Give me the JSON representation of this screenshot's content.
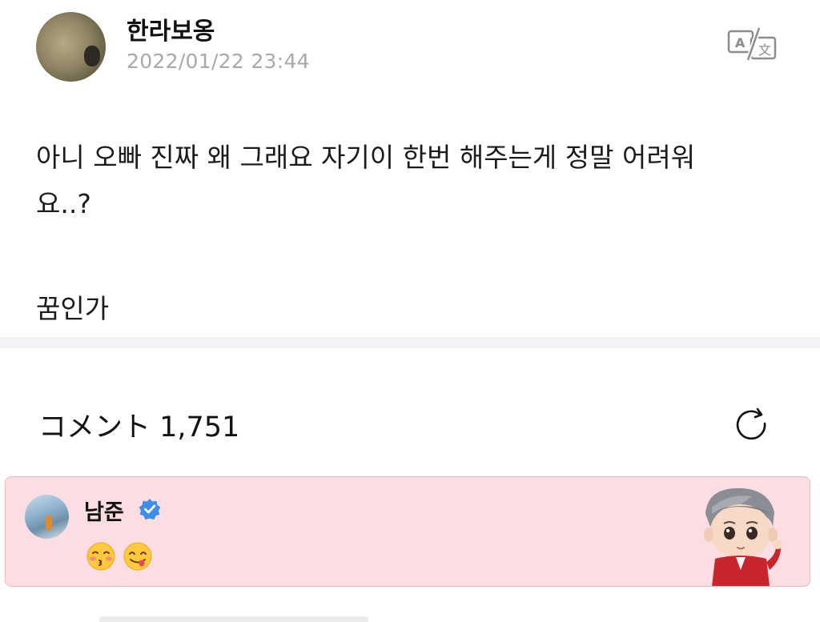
{
  "post": {
    "author": "한라보옹",
    "timestamp": "2022/01/22 23:44",
    "body_line1": "아니 오빠 진짜 왜 그래요 자기이 한번 해주는게 정말 어려워",
    "body_line2": "요..?",
    "body_line3": "꿈인가",
    "translate_icon": "translate-icon"
  },
  "comments": {
    "header": "コメント 1,751",
    "refresh_icon": "refresh-icon",
    "pinned": {
      "author": "남준",
      "verified_icon": "verified-badge-icon",
      "emojis": [
        "kissing-face-emoji",
        "savoring-face-emoji"
      ],
      "background": "#fcdde1"
    }
  }
}
